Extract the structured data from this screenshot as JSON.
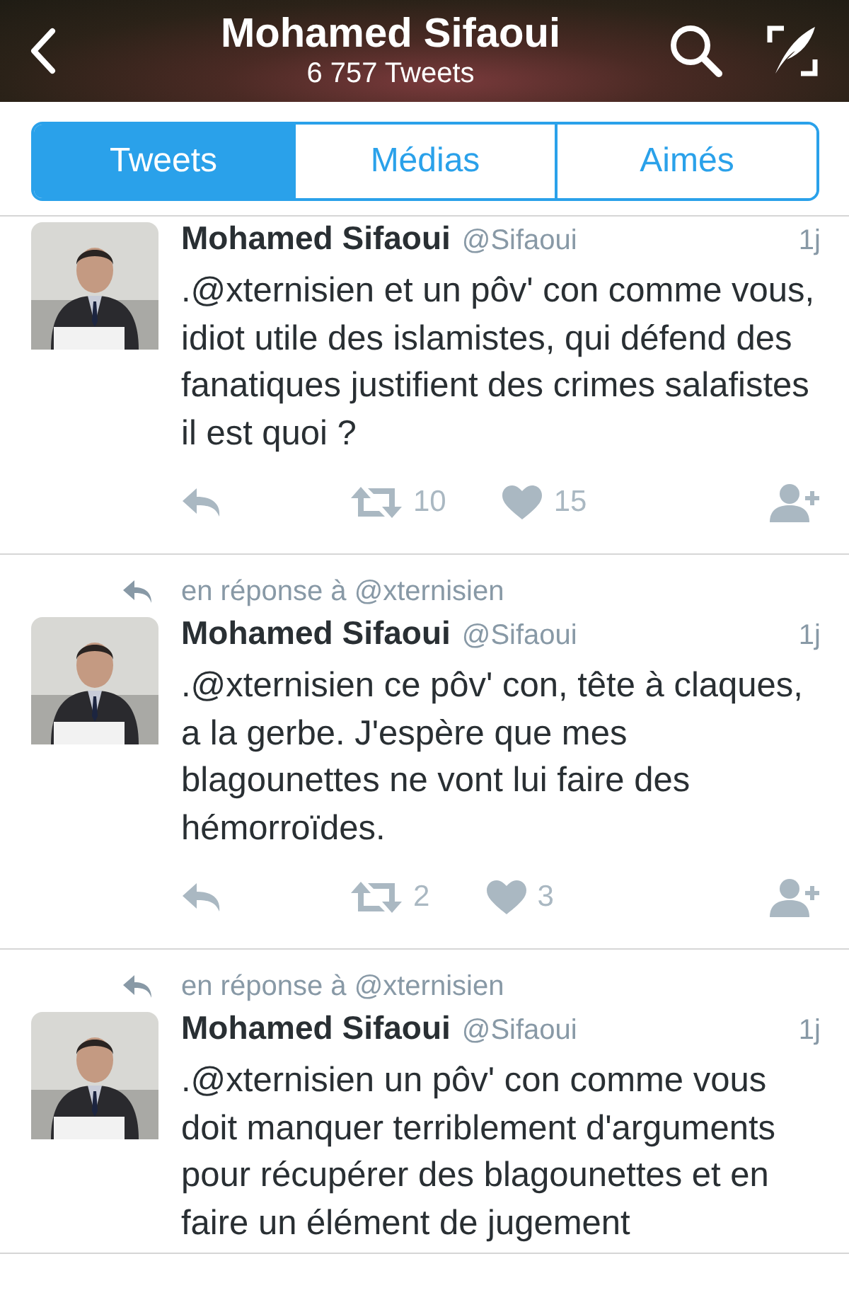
{
  "header": {
    "title": "Mohamed Sifaoui",
    "subtitle": "6 757 Tweets"
  },
  "tabs": [
    {
      "label": "Tweets",
      "selected": true
    },
    {
      "label": "Médias",
      "selected": false
    },
    {
      "label": "Aimés",
      "selected": false
    }
  ],
  "tweets": [
    {
      "name": "Mohamed Sifaoui",
      "handle": "@Sifaoui",
      "time": "1j",
      "text": ".@xternisien et un pôv' con comme vous, idiot utile des islamistes, qui défend des fanatiques justifient des crimes salafistes il est quoi ?",
      "retweets": "10",
      "likes": "15"
    },
    {
      "reply_to": "en réponse à @xternisien",
      "name": "Mohamed Sifaoui",
      "handle": "@Sifaoui",
      "time": "1j",
      "text": ".@xternisien ce pôv' con, tête à claques, a la gerbe. J'espère que mes blagounettes ne vont lui faire des hémorroïdes.",
      "retweets": "2",
      "likes": "3"
    },
    {
      "reply_to": "en réponse à @xternisien",
      "name": "Mohamed Sifaoui",
      "handle": "@Sifaoui",
      "time": "1j",
      "text": ".@xternisien un pôv' con comme vous doit manquer terriblement d'arguments pour récupérer des blagounettes et en faire un élément de jugement"
    }
  ]
}
